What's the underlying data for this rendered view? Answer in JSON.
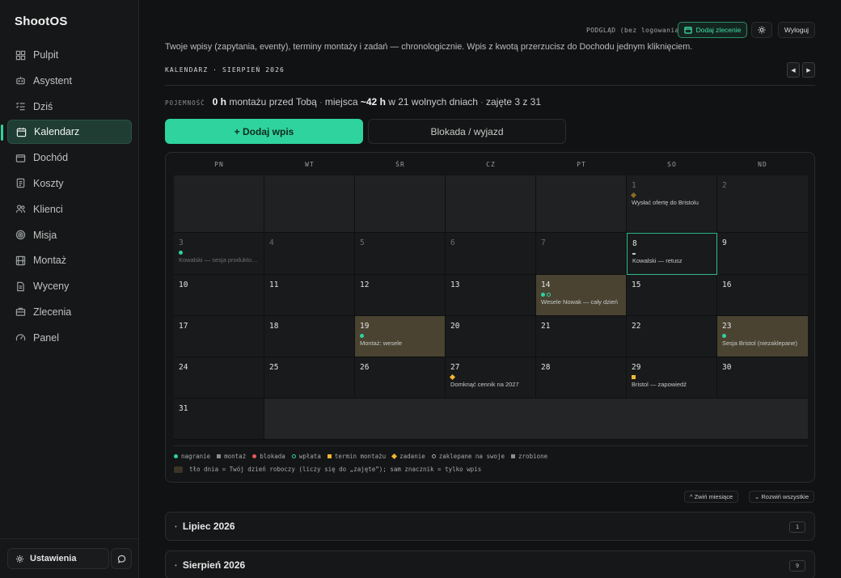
{
  "app": {
    "name": "ShootOS"
  },
  "sidebar": {
    "items": [
      {
        "label": "Pulpit",
        "icon": "dashboard-icon"
      },
      {
        "label": "Asystent",
        "icon": "robot-icon"
      },
      {
        "label": "Dziś",
        "icon": "checklist-icon"
      },
      {
        "label": "Kalendarz",
        "icon": "calendar-icon",
        "active": true
      },
      {
        "label": "Dochód",
        "icon": "wallet-icon"
      },
      {
        "label": "Koszty",
        "icon": "receipt-icon"
      },
      {
        "label": "Klienci",
        "icon": "users-icon"
      },
      {
        "label": "Misja",
        "icon": "target-icon"
      },
      {
        "label": "Montaż",
        "icon": "film-icon"
      },
      {
        "label": "Wyceny",
        "icon": "document-icon"
      },
      {
        "label": "Zlecenia",
        "icon": "briefcase-icon"
      },
      {
        "label": "Panel",
        "icon": "gauge-icon"
      }
    ],
    "settings_label": "Ustawienia"
  },
  "topbar": {
    "preview": "PODGLĄD (bez logowania)",
    "add_order": "Dodaj zlecenie",
    "logout": "Wyloguj"
  },
  "intro": "Twoje wpisy (zapytania, eventy), terminy montaży i zadań — chronologicznie. Wpis z kwotą przerzucisz do Dochodu jednym kliknięciem.",
  "calendar_title": "KALENDARZ · SIERPIEŃ 2026",
  "nav": {
    "prev": "◀",
    "next": "▶"
  },
  "capacity": {
    "label": "POJEMNOŚĆ",
    "hours": "0 h",
    "text1": "montażu przed Tobą",
    "sep": "·",
    "text2": "miejsca",
    "free_hours": "~42 h",
    "text3": "w 21 wolnych dniach",
    "text4": "zajęte 3 z 31"
  },
  "actions": {
    "add_entry": "+ Dodaj wpis",
    "block": "Blokada / wyjazd"
  },
  "weekdays": [
    "PN",
    "WT",
    "ŚR",
    "CZ",
    "PT",
    "SO",
    "ND"
  ],
  "weeks": [
    [
      {
        "type": "empty"
      },
      {
        "type": "empty"
      },
      {
        "type": "empty"
      },
      {
        "type": "empty"
      },
      {
        "type": "empty"
      },
      {
        "day": "1",
        "type": "out",
        "mark": "diamond-dim",
        "event": "Wysłać ofertę do Bristolu"
      },
      {
        "day": "2",
        "type": "out"
      }
    ],
    [
      {
        "day": "3",
        "type": "dim",
        "mark": "dot",
        "event": "Kowalski — sesja produktowa"
      },
      {
        "day": "4",
        "type": "dim"
      },
      {
        "day": "5",
        "type": "dim"
      },
      {
        "day": "6",
        "type": "dim"
      },
      {
        "day": "7",
        "type": "dim"
      },
      {
        "day": "8",
        "type": "today",
        "mark": "dash",
        "event": "Kowalski — retusz"
      },
      {
        "day": "9"
      }
    ],
    [
      {
        "day": "10"
      },
      {
        "day": "11"
      },
      {
        "day": "12"
      },
      {
        "day": "13"
      },
      {
        "day": "14",
        "type": "worked",
        "mark": "dot-ring",
        "event": "Wesele Nowak — cały dzień"
      },
      {
        "day": "15"
      },
      {
        "day": "16"
      }
    ],
    [
      {
        "day": "17"
      },
      {
        "day": "18"
      },
      {
        "day": "19",
        "type": "worked",
        "mark": "dot",
        "event": "Montaż: wesele"
      },
      {
        "day": "20"
      },
      {
        "day": "21"
      },
      {
        "day": "22"
      },
      {
        "day": "23",
        "type": "worked",
        "mark": "dot",
        "event": "Sesja Bristol (niezaklepane)"
      }
    ],
    [
      {
        "day": "24"
      },
      {
        "day": "25"
      },
      {
        "day": "26"
      },
      {
        "day": "27",
        "mark": "diamond",
        "event": "Domknąć cennik na 2027"
      },
      {
        "day": "28"
      },
      {
        "day": "29",
        "mark": "square",
        "event": "Bristol — zapowiedź"
      },
      {
        "day": "30"
      }
    ],
    [
      {
        "day": "31"
      }
    ]
  ],
  "legend": {
    "items": [
      {
        "label": "nagranie",
        "icon": "dot-green"
      },
      {
        "label": "montaż",
        "icon": "square-grey"
      },
      {
        "label": "blokada",
        "icon": "dot-red"
      },
      {
        "label": "wpłata",
        "icon": "ring-green"
      },
      {
        "label": "termin montażu",
        "icon": "square-yellow"
      },
      {
        "label": "zadanie",
        "icon": "diamond-yellow"
      },
      {
        "label": "zaklepane na swoje",
        "icon": "ring-grey"
      },
      {
        "label": "zrobione",
        "icon": "square-grey"
      }
    ],
    "note": "tło dnia = Twój dzień roboczy (liczy się do „zajęte”); sam znacznik = tylko wpis"
  },
  "controls": {
    "collapse": "^ Zwiń miesiące",
    "expand": "⌄ Rozwiń wszystkie"
  },
  "months": [
    {
      "name": "Lipiec 2026",
      "count": "1"
    },
    {
      "name": "Sierpień 2026",
      "count": "9"
    }
  ],
  "colors": {
    "accent": "#2fd39d",
    "worked_day": "#4a4332",
    "task": "#f0b72f",
    "block": "#e55a5a"
  }
}
